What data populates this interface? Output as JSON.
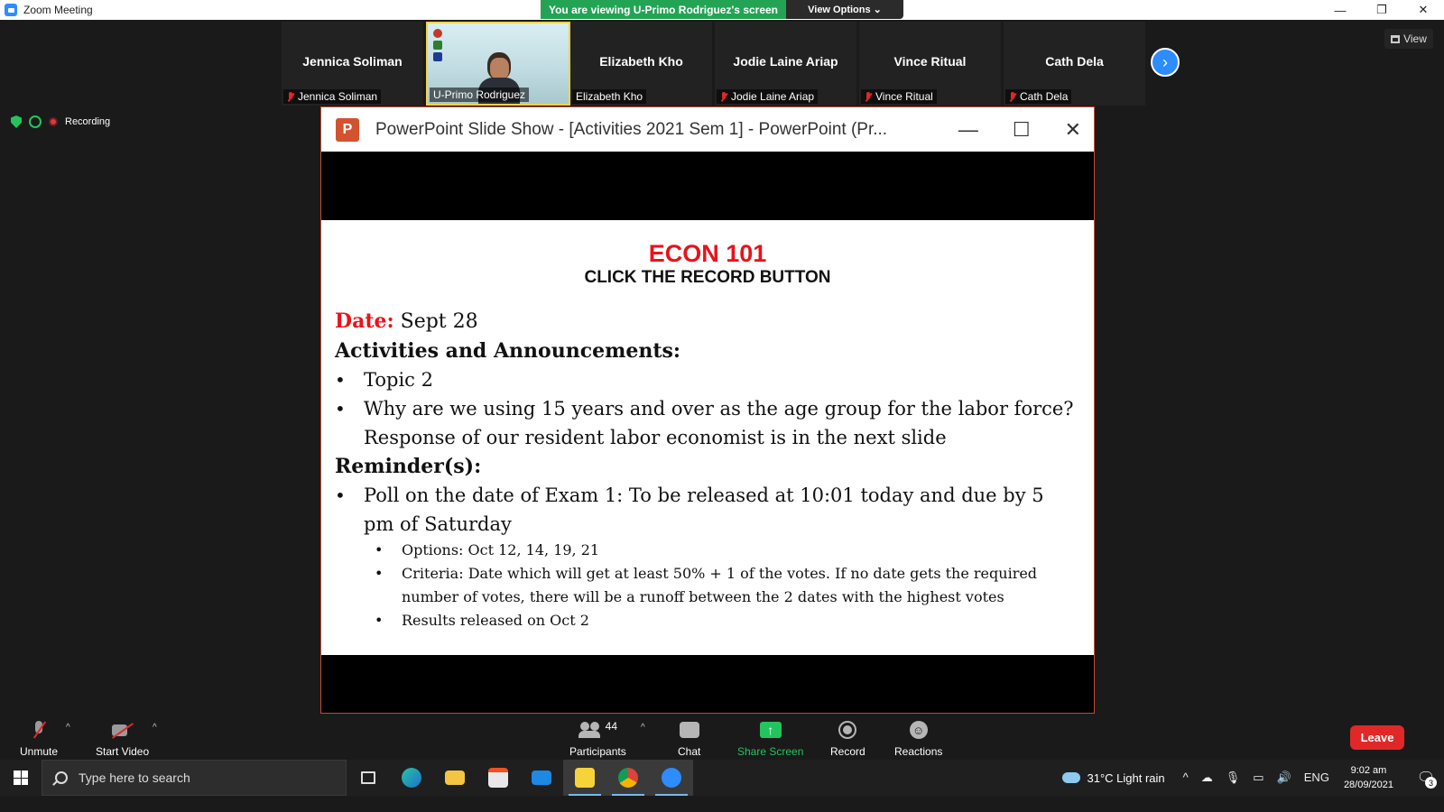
{
  "window": {
    "title": "Zoom Meeting",
    "controls": [
      "—",
      "❐",
      "✕"
    ]
  },
  "banner": {
    "viewing": "You are viewing U-Primo Rodriguez's screen",
    "view_options": "View Options ⌄"
  },
  "gallery": [
    {
      "big_name": "Jennica Soliman",
      "tag": "Jennica Soliman",
      "muted": true,
      "video": false
    },
    {
      "big_name": "",
      "tag": "U-Primo Rodriguez",
      "muted": false,
      "video": true
    },
    {
      "big_name": "Elizabeth Kho",
      "tag": "Elizabeth Kho",
      "muted": false,
      "video": false
    },
    {
      "big_name": "Jodie Laine Ariap",
      "tag": "Jodie Laine Ariap",
      "muted": true,
      "video": false
    },
    {
      "big_name": "Vince Ritual",
      "tag": "Vince Ritual",
      "muted": true,
      "video": false
    },
    {
      "big_name": "Cath Dela",
      "tag": "Cath Dela",
      "muted": true,
      "video": false
    }
  ],
  "view_button": "View",
  "status": {
    "recording": "Recording"
  },
  "ppt": {
    "title": "PowerPoint Slide Show - [Activities 2021 Sem 1] - PowerPoint (Pr...",
    "icon_letter": "P",
    "controls": [
      "—",
      "☐",
      "✕"
    ],
    "slide": {
      "title": "ECON 101",
      "subtitle": "CLICK THE RECORD BUTTON",
      "date_label": "Date:",
      "date_value": "Sept 28",
      "activities_heading": "Activities and Announcements:",
      "activities": [
        "Topic 2",
        "Why are we using 15 years and over as the age group for the labor force? Response of our resident labor economist is in the next slide"
      ],
      "reminders_heading": "Reminder(s):",
      "reminders": [
        "Poll on the date of Exam 1: To be released at 10:01 today and due by 5 pm of Saturday"
      ],
      "sub_reminders": [
        "Options: Oct 12, 14, 19, 21",
        "Criteria: Date which will get at least 50% + 1 of the votes. If no date gets the required number of votes, there will be a runoff between the 2 dates with the highest votes",
        "Results released on Oct 2"
      ]
    }
  },
  "toolbar": {
    "unmute": "Unmute",
    "start_video": "Start Video",
    "participants": "Participants",
    "participants_count": "44",
    "chat": "Chat",
    "share_screen": "Share Screen",
    "record": "Record",
    "reactions": "Reactions",
    "leave": "Leave"
  },
  "taskbar": {
    "search_placeholder": "Type here to search",
    "weather": "31°C  Light rain",
    "lang": "ENG",
    "time": "9:02 am",
    "date": "28/09/2021",
    "notifications": "3"
  },
  "colors": {
    "zoom_blue": "#2d8cff",
    "banner_green": "#23a455",
    "slide_red": "#e8131b",
    "leave_red": "#e02828"
  }
}
